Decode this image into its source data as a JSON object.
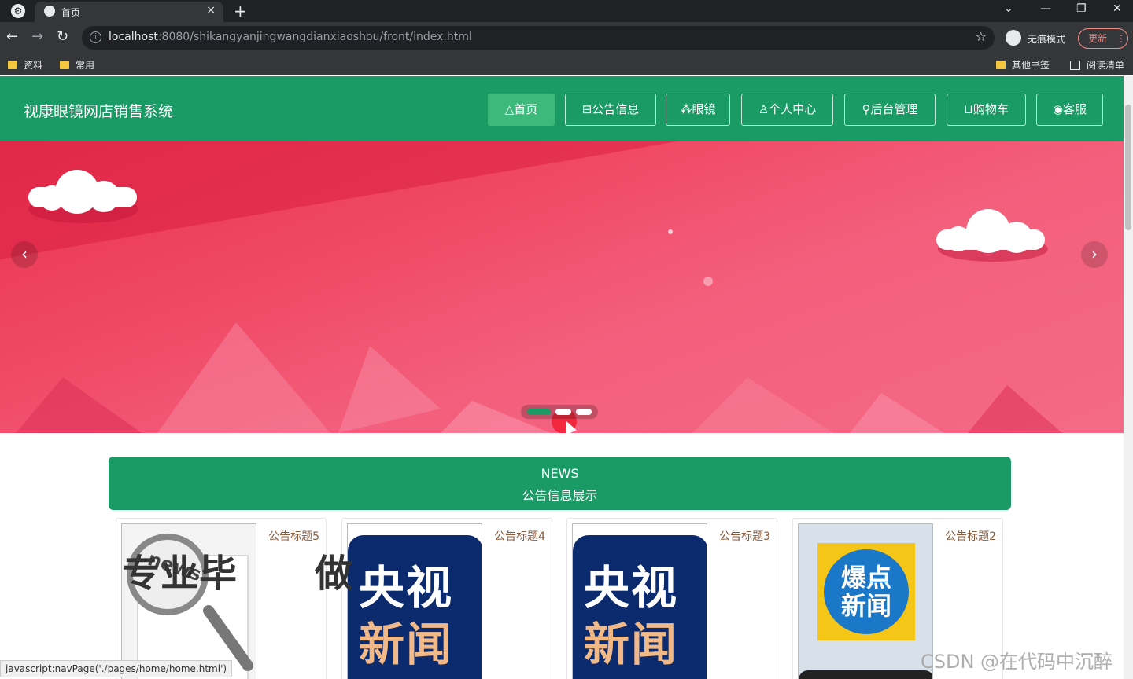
{
  "browser": {
    "tab_title": "首页",
    "tab_close": "×",
    "new_tab": "+",
    "url_host": "localhost",
    "url_rest": ":8080/shikangyanjingwangdianxiaoshou/front/index.html",
    "incognito_label": "无痕模式",
    "update_label": "更新",
    "more": "⋮",
    "back": "←",
    "forward": "→",
    "reload": "↻",
    "star": "☆",
    "minimize": "—",
    "restore": "❐",
    "close": "✕",
    "tab_list": "⌄",
    "bookmarks": {
      "left": [
        "资料",
        "常用"
      ],
      "other": "其他书签",
      "reading_list": "阅读清单"
    }
  },
  "header": {
    "site_title": "视康眼镜网店销售系统",
    "nav": [
      {
        "label": "△首页",
        "active": true
      },
      {
        "label": "⊟公告信息",
        "active": false
      },
      {
        "label": "⁂眼镜",
        "active": false
      },
      {
        "label": "♙个人中心",
        "active": false
      },
      {
        "label": "⚲后台管理",
        "active": false
      },
      {
        "label": "⊔购物车",
        "active": false
      },
      {
        "label": "◉客服",
        "active": false
      }
    ]
  },
  "carousel": {
    "prev": "‹",
    "next": "›",
    "slide_count": 3,
    "active_index": 0
  },
  "news": {
    "heading_en": "NEWS",
    "heading_cn": "公告信息展示",
    "cards": [
      {
        "title": "公告标题5",
        "image": "news-magnifier"
      },
      {
        "title": "公告标题4",
        "image": "cctv-news"
      },
      {
        "title": "公告标题3",
        "image": "cctv-news"
      },
      {
        "title": "公告标题2",
        "image": "hot-news"
      }
    ],
    "cctv_line1": "央视",
    "cctv_line2": "新闻",
    "hot_news_text": "爆点新闻",
    "news_stamp": "news"
  },
  "overlay_caption": "专业毕　　做",
  "status_url": "javascript:navPage('./pages/home/home.html')",
  "watermark": "CSDN @在代码中沉醉",
  "colors": {
    "brand_green": "#1a9a64",
    "banner_red": "#f04a66"
  }
}
